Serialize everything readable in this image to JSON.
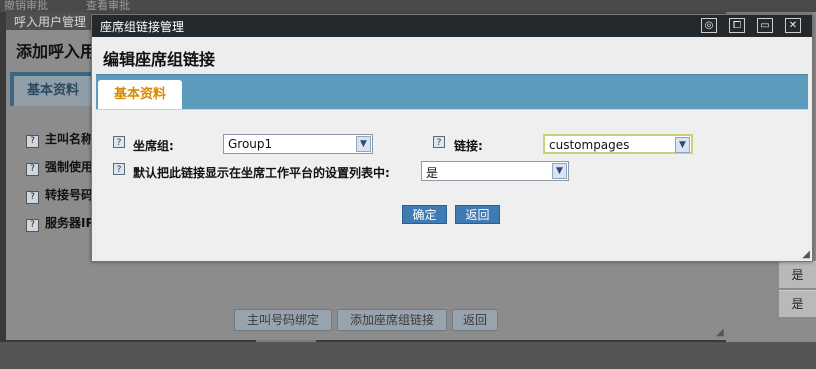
{
  "background": {
    "topbar": [
      "撤销审批",
      "查看审批"
    ],
    "right_column_values": [
      "是",
      "是"
    ]
  },
  "outer_window": {
    "title": "呼入用户管理",
    "heading": "添加呼入用户",
    "tab": "基本资料",
    "fields": [
      "主叫名称",
      "强制使用",
      "转接号码",
      "服务器IP"
    ],
    "buttons": {
      "bind_number": "主叫号码绑定",
      "add_link": "添加座席组链接",
      "back": "返回"
    }
  },
  "dialog": {
    "title": "座席组链接管理",
    "heading": "编辑座席组链接",
    "tab": "基本资料",
    "help_icon_glyph": "?",
    "fields": {
      "agent_group_label": "坐席组:",
      "agent_group_value": "Group1",
      "link_label": "链接:",
      "link_value": "custompages",
      "display_label": "默认把此链接显示在坐席工作平台的设置列表中:",
      "display_value": "是"
    },
    "buttons": {
      "confirm": "确定",
      "back": "返回"
    },
    "titlebar_icons": [
      "restore-icon",
      "maximize-icon",
      "minimize-icon",
      "close-icon"
    ]
  },
  "colors": {
    "titlebar": "#24292d",
    "tabbar": "#5b9cbd",
    "active_tab_text": "#d58a00",
    "button": "#3f7bb2"
  }
}
